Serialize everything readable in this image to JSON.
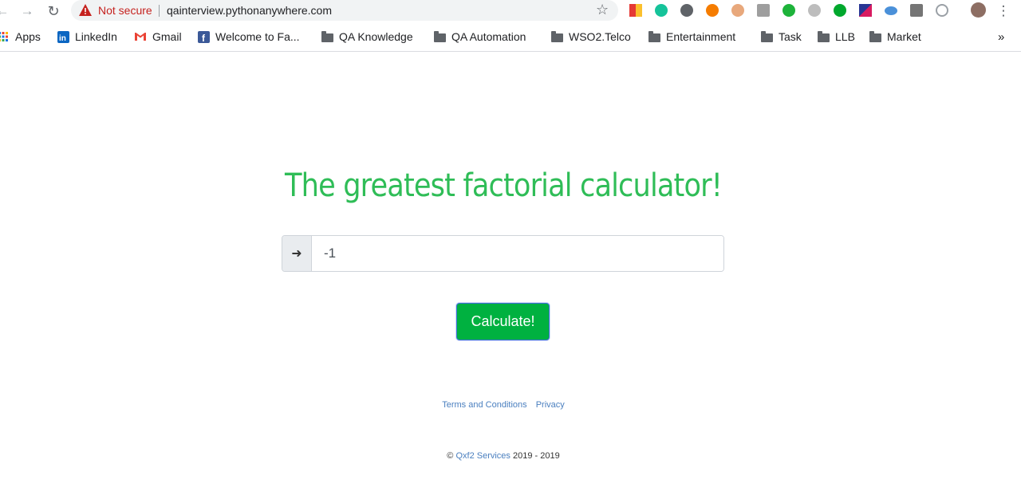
{
  "browser": {
    "security_label": "Not secure",
    "url": "qainterview.pythonanywhere.com",
    "bookmarks": [
      {
        "label": "Apps",
        "icon": "apps-grid-icon"
      },
      {
        "label": "LinkedIn",
        "icon": "linkedin-icon"
      },
      {
        "label": "Gmail",
        "icon": "gmail-icon"
      },
      {
        "label": "Welcome to Fa...",
        "icon": "facebook-icon"
      },
      {
        "label": "QA Knowledge",
        "icon": "folder-icon"
      },
      {
        "label": "QA Automation",
        "icon": "folder-icon"
      },
      {
        "label": "WSO2.Telco",
        "icon": "folder-icon"
      },
      {
        "label": "Entertainment",
        "icon": "folder-icon"
      },
      {
        "label": "Task",
        "icon": "folder-icon"
      },
      {
        "label": "LLB",
        "icon": "folder-icon"
      },
      {
        "label": "Market",
        "icon": "folder-icon"
      }
    ],
    "more_bookmarks_glyph": "»"
  },
  "page": {
    "title": "The greatest factorial calculator!",
    "input": {
      "value": "-1",
      "addon_icon": "arrow-right-icon"
    },
    "calculate_label": "Calculate!",
    "footer": {
      "terms_label": "Terms and Conditions",
      "privacy_label": "Privacy",
      "copyright_symbol": "©",
      "company": "Qxf2 Services",
      "years": "2019 - 2019"
    }
  },
  "colors": {
    "title": "#2fbd57",
    "button": "#00b140",
    "link": "#4a7fbf",
    "warning": "#c5221f"
  }
}
